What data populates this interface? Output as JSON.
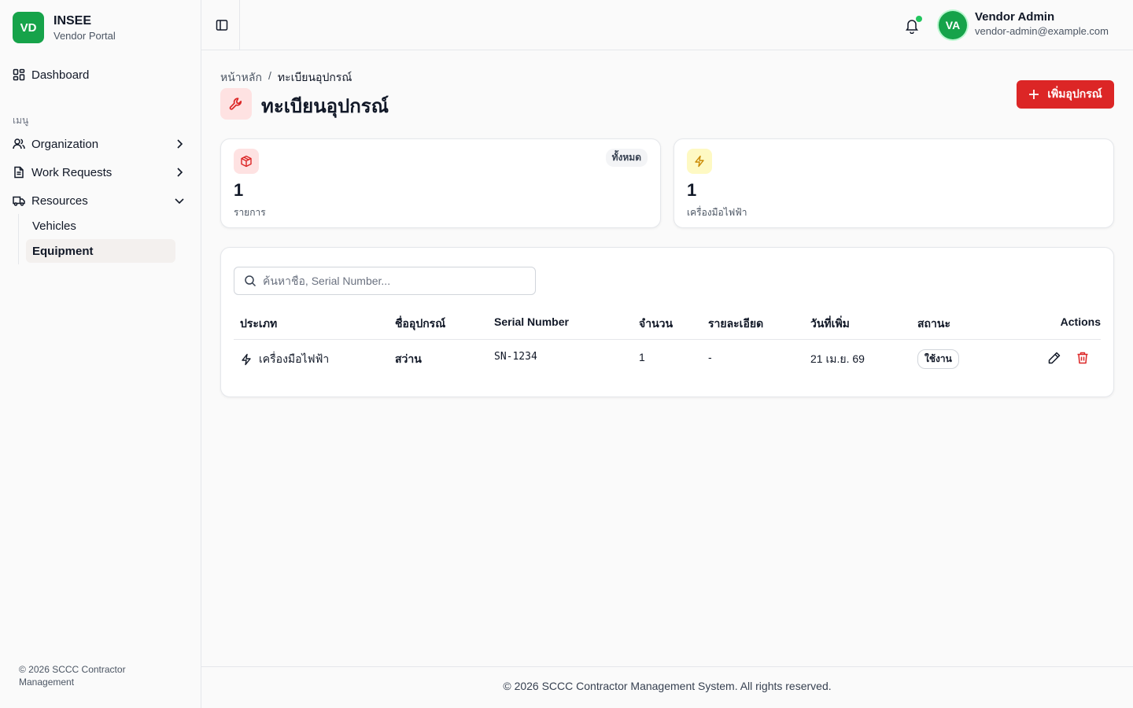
{
  "brand": {
    "logo": "VD",
    "name": "INSEE",
    "subtitle": "Vendor Portal",
    "color": "#16a34a"
  },
  "sidebar": {
    "dashboard": {
      "label": "Dashboard",
      "icon": "dashboard-grid-icon"
    },
    "section_label": "เมนู",
    "items": [
      {
        "label": "Organization",
        "icon": "users-icon",
        "expanded": false
      },
      {
        "label": "Work Requests",
        "icon": "document-icon",
        "expanded": false
      },
      {
        "label": "Resources",
        "icon": "truck-icon",
        "expanded": true
      }
    ],
    "sub_items": [
      {
        "label": "Vehicles",
        "active": false
      },
      {
        "label": "Equipment",
        "active": true
      }
    ],
    "footer": "© 2026 SCCC Contractor Management"
  },
  "header": {
    "notification_dot": true,
    "user": {
      "initials": "VA",
      "name": "Vendor Admin",
      "email": "vendor-admin@example.com"
    }
  },
  "page": {
    "breadcrumb": [
      "หน้าหลัก",
      "/",
      "ทะเบียนอุปกรณ์"
    ],
    "title": "ทะเบียนอุปกรณ์",
    "add_button": "เพิ่มอุปกรณ์",
    "accent": "#dc2626"
  },
  "stats": [
    {
      "value": "1",
      "label": "รายการ",
      "badge": "ทั้งหมด",
      "icon": "box-icon"
    },
    {
      "value": "1",
      "label": "เครื่องมือไฟฟ้า",
      "icon": "lightning-icon"
    }
  ],
  "search": {
    "placeholder": "ค้นหาชื่อ, Serial Number...",
    "value": ""
  },
  "table": {
    "columns": [
      "ประเภท",
      "ชื่ออุปกรณ์",
      "Serial Number",
      "จำนวน",
      "รายละเอียด",
      "วันที่เพิ่ม",
      "สถานะ",
      "Actions"
    ],
    "rows": [
      {
        "type": "เครื่องมือไฟฟ้า",
        "name": "สว่าน",
        "serial": "SN-1234",
        "qty": "1",
        "detail": "-",
        "date": "21 เม.ย. 69",
        "status": "ใช้งาน"
      }
    ]
  },
  "footer": "© 2026 SCCC Contractor Management System. All rights reserved."
}
